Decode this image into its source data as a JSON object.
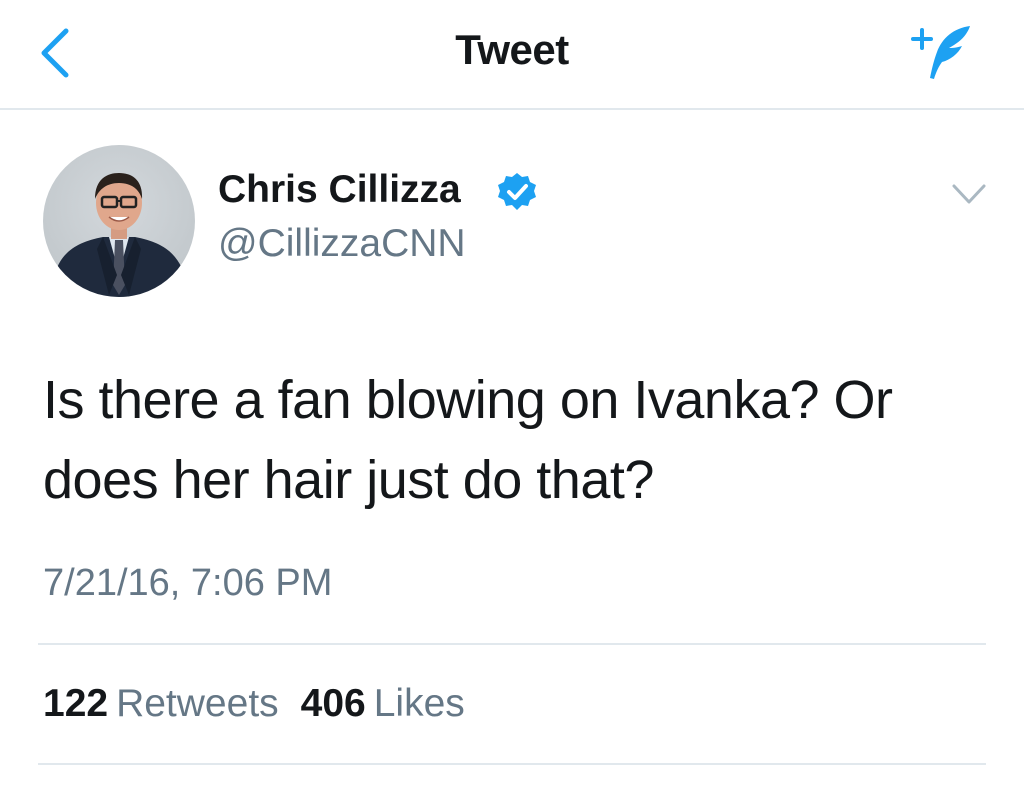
{
  "colors": {
    "accent": "#1da1f2",
    "text": "#14171a",
    "secondary": "#657786",
    "divider": "#e1e8ed"
  },
  "nav": {
    "title": "Tweet",
    "back_icon": "chevron-left-icon",
    "compose_icon": "compose-tweet-icon"
  },
  "tweet": {
    "author_name": "Chris Cillizza",
    "author_handle": "@CillizzaCNN",
    "verified": true,
    "text": "Is there a fan blowing on Ivanka? Or does her hair just do that?",
    "timestamp": "7/21/16, 7:06 PM",
    "retweets_count": "122",
    "retweets_label": "Retweets",
    "likes_count": "406",
    "likes_label": "Likes"
  }
}
